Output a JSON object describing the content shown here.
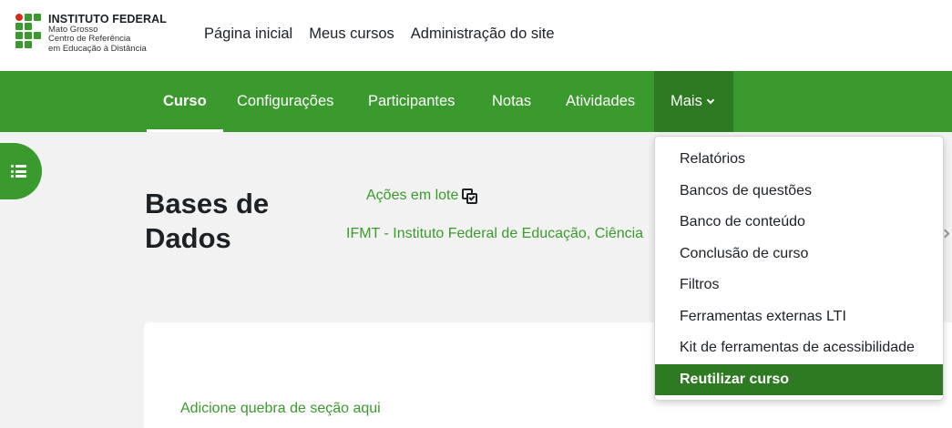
{
  "logo": {
    "title": "INSTITUTO FEDERAL",
    "line1": "Mato Grosso",
    "line2": "Centro de Referência",
    "line3": "em Educação à Distância"
  },
  "top_nav": [
    "Página inicial",
    "Meus cursos",
    "Administração do site"
  ],
  "course_nav": {
    "items": [
      "Curso",
      "Configurações",
      "Participantes",
      "Notas",
      "Atividades"
    ],
    "active": "Curso",
    "more_label": "Mais"
  },
  "more_menu": {
    "items": [
      "Relatórios",
      "Bancos de questões",
      "Banco de conteúdo",
      "Conclusão de curso",
      "Filtros",
      "Ferramentas externas LTI",
      "Kit de ferramentas de acessibilidade",
      "Reutilizar curso"
    ],
    "selected": "Reutilizar curso"
  },
  "course": {
    "title_line1": "Bases de",
    "title_line2": "Dados",
    "batch_actions": "Ações em lote",
    "organization": "IFMT - Instituto Federal de Educação, Ciência"
  },
  "content": {
    "add_break": "Adicione quebra de seção aqui"
  },
  "colors": {
    "brand_green": "#3b9a2d",
    "dark_green": "#2d7a22",
    "logo_red": "#d52b1e"
  },
  "icons": [
    "list-icon",
    "chevron-down-icon",
    "batch-actions-icon",
    "chevron-right-icon"
  ]
}
